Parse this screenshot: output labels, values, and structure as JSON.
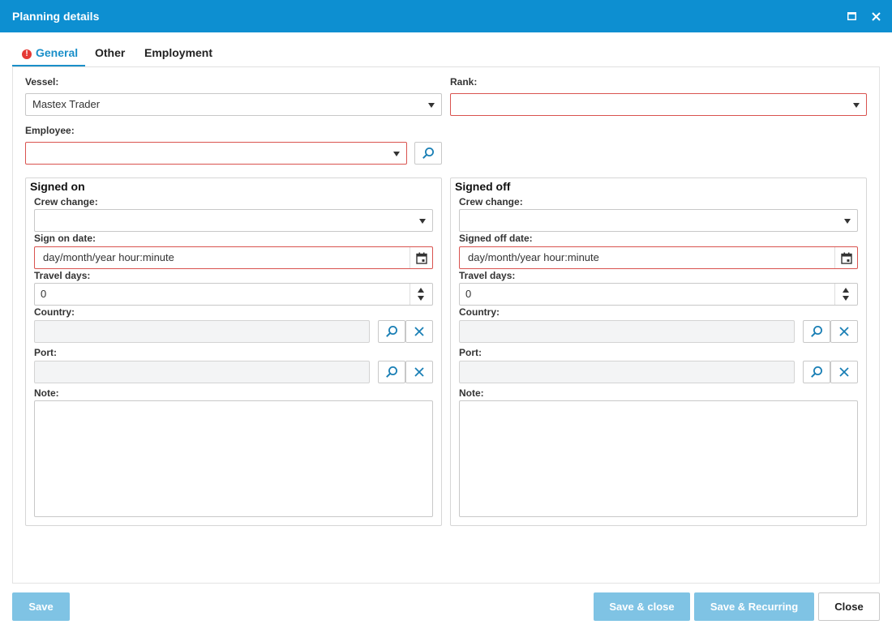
{
  "window": {
    "title": "Planning details"
  },
  "tabs": [
    {
      "label": "General",
      "has_error": true
    },
    {
      "label": "Other"
    },
    {
      "label": "Employment"
    }
  ],
  "general": {
    "vessel": {
      "label": "Vessel:",
      "value": "Mastex Trader"
    },
    "rank": {
      "label": "Rank:",
      "value": ""
    },
    "employee": {
      "label": "Employee:",
      "value": ""
    }
  },
  "signed_on": {
    "title": "Signed on",
    "crew_change": {
      "label": "Crew change:",
      "value": ""
    },
    "date": {
      "label": "Sign on date:",
      "placeholder": "day/month/year hour:minute"
    },
    "travel_days": {
      "label": "Travel days:",
      "value": "0"
    },
    "country": {
      "label": "Country:",
      "value": ""
    },
    "port": {
      "label": "Port:",
      "value": ""
    },
    "note": {
      "label": "Note:",
      "value": ""
    }
  },
  "signed_off": {
    "title": "Signed off",
    "crew_change": {
      "label": "Crew change:",
      "value": ""
    },
    "date": {
      "label": "Signed off date:",
      "placeholder": "day/month/year hour:minute"
    },
    "travel_days": {
      "label": "Travel days:",
      "value": "0"
    },
    "country": {
      "label": "Country:",
      "value": ""
    },
    "port": {
      "label": "Port:",
      "value": ""
    },
    "note": {
      "label": "Note:",
      "value": ""
    }
  },
  "footer": {
    "save": "Save",
    "save_close": "Save & close",
    "save_recurring": "Save & Recurring",
    "close": "Close"
  },
  "colors": {
    "accent": "#0d8fd1",
    "error": "#d9534f",
    "button_primary": "#7fc3e4",
    "icon": "#1a7fb5"
  }
}
